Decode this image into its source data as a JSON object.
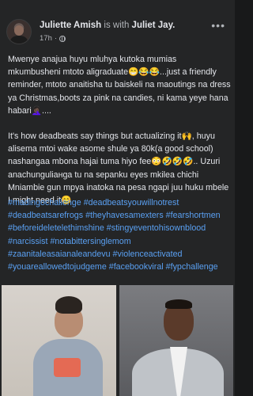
{
  "post": {
    "author": "Juliette Amish",
    "with_text": "is with",
    "tagged": "Juliet Jay.",
    "time": "17h",
    "more_icon": "more-horizontal-icon",
    "privacy_icon": "globe-icon",
    "paragraph1": "Mwenye anajua huyu mluhya kutoka mumias mkumbusheni mtoto aligraduate😁😂😂...just a friendly reminder, mtoto anaitisha tu baiskeli na maoutings na dress ya Christmas,boots za pink na candies, ni kama yeye hana habari🤦🏿‍♀️....",
    "paragraph2": "It's how deadbeats say things but actualizing it🙌, huyu alisema mtoi wake asome shule ya 80k(a good school) nashangaa mbona hajai tuma hiyo fee😳🤣🤣🤣.. Uzuri anachunguliaнga tu na sepanku eyes mkilea chichi Mniambie gun mpya inatoka na pesa ngapi juu huku mbele I might need it😊",
    "hashtags": [
      "#madingochallenge",
      "#deadbeatsyouwillnotrest",
      "#deadbeatsarefrogs",
      "#theyhavesamexters",
      "#fearshortmen",
      "#beforeideletelethimshine",
      "#stingyeventohisownblood",
      "#narcissist",
      "#notabittersinglemom",
      "#zaanitaleasaianaleandevu",
      "#violenceactivated",
      "#youareallowedtojudgeme",
      "#facebookviral",
      "#fypchallenge"
    ]
  }
}
